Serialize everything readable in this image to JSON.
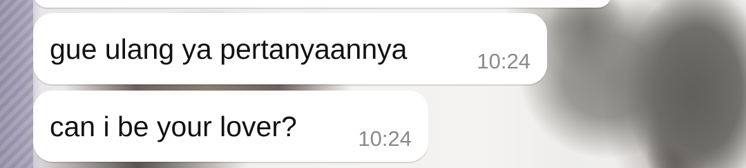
{
  "messages": [
    {
      "text": "gue ulang ya pertanyaannya",
      "time": "10:24"
    },
    {
      "text": "can i be your lover?",
      "time": "10:24"
    }
  ],
  "colors": {
    "bubble_background": "#ffffff",
    "message_text": "#111111",
    "timestamp_text": "#8a8a8a"
  }
}
